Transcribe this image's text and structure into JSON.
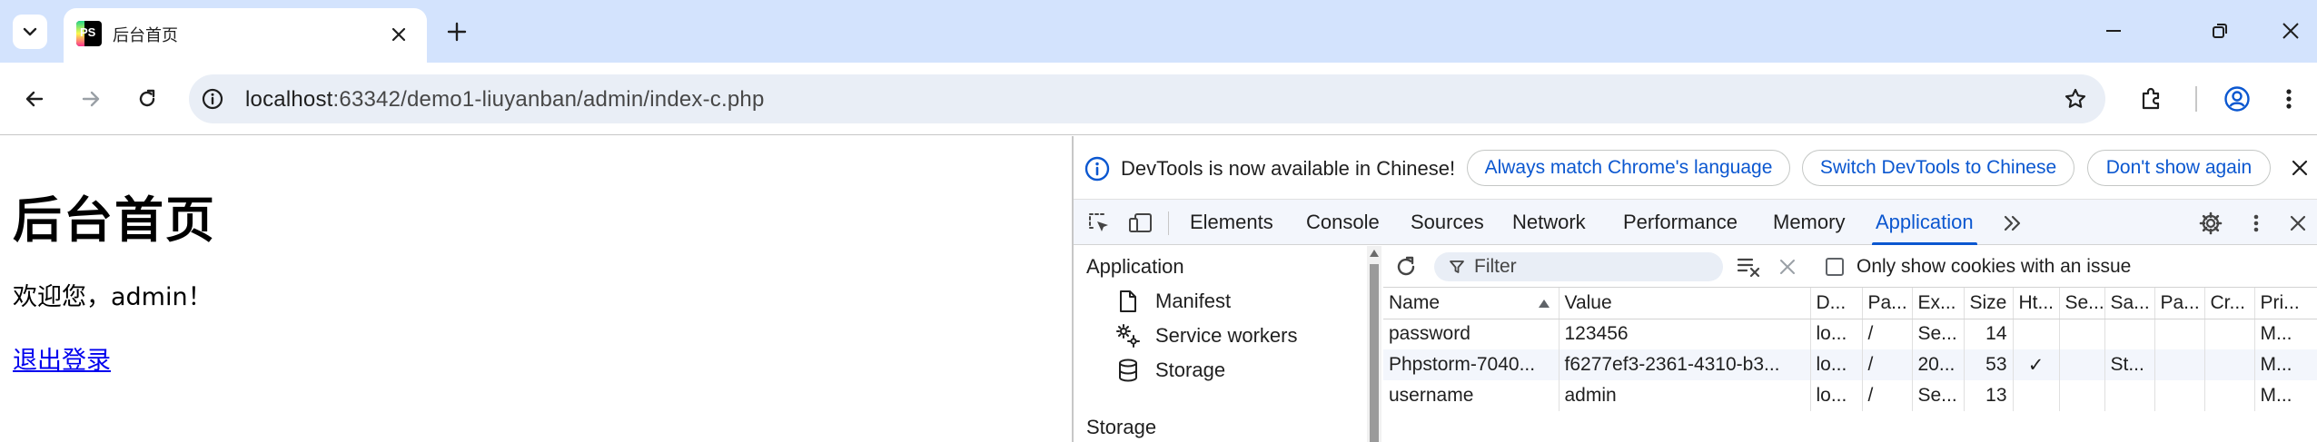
{
  "browser": {
    "tab": {
      "title": "后台首页",
      "favicon_text": "PS"
    },
    "url": {
      "host": "localhost",
      "path": ":63342/demo1-liuyanban/admin/index-c.php"
    }
  },
  "page": {
    "heading": "后台首页",
    "welcome": "欢迎您，admin！",
    "logout_link": "退出登录"
  },
  "devtools": {
    "infobar": {
      "message": "DevTools is now available in Chinese!",
      "buttons": [
        "Always match Chrome's language",
        "Switch DevTools to Chinese",
        "Don't show again"
      ]
    },
    "tabs": [
      "Elements",
      "Console",
      "Sources",
      "Network",
      "Performance",
      "Memory",
      "Application"
    ],
    "active_tab": "Application",
    "nav": {
      "section_application": "Application",
      "items": [
        {
          "label": "Manifest",
          "icon": "file-icon"
        },
        {
          "label": "Service workers",
          "icon": "gears-icon"
        },
        {
          "label": "Storage",
          "icon": "database-icon"
        }
      ],
      "section_storage": "Storage"
    },
    "cookies": {
      "filter_placeholder": "Filter",
      "issue_checkbox_label": "Only show cookies with an issue",
      "columns": [
        "Name",
        "Value",
        "D...",
        "Pa...",
        "Ex...",
        "Size",
        "Ht...",
        "Se...",
        "Sa...",
        "Pa...",
        "Cr...",
        "Pri..."
      ],
      "rows": [
        [
          "password",
          "123456",
          "lo...",
          "/",
          "Se...",
          "14",
          "",
          "",
          "",
          "",
          "",
          "M..."
        ],
        [
          "Phpstorm-7040...",
          "f6277ef3-2361-4310-b3...",
          "lo...",
          "/",
          "20...",
          "53",
          "✓",
          "",
          "St...",
          "",
          "",
          "M..."
        ],
        [
          "username",
          "admin",
          "lo...",
          "/",
          "Se...",
          "13",
          "",
          "",
          "",
          "",
          "",
          "M..."
        ]
      ]
    }
  }
}
